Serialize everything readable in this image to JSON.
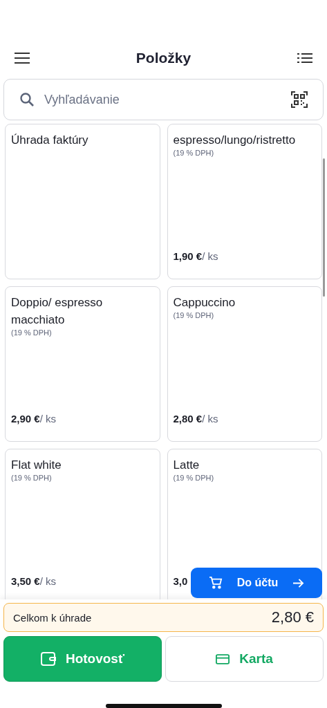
{
  "header": {
    "title": "Položky"
  },
  "search": {
    "placeholder": "Vyhľadávanie"
  },
  "items": [
    {
      "name": "Úhrada faktúry"
    },
    {
      "name": "espresso/lungo/ristretto",
      "vat": "(19 % DPH)",
      "price": "1,90 €",
      "unit": "/ ks"
    },
    {
      "name": "Doppio/ espresso macchiato",
      "vat": "(19 % DPH)",
      "price": "2,90 €",
      "unit": "/ ks"
    },
    {
      "name": "Cappuccino",
      "vat": "(19 % DPH)",
      "price": "2,80 €",
      "unit": "/ ks"
    },
    {
      "name": "Flat white",
      "vat": "(19 % DPH)",
      "price": "3,50 €",
      "unit": "/ ks"
    },
    {
      "name": "Latte",
      "vat": "(19 % DPH)",
      "price": "3,0"
    }
  ],
  "cart_button": {
    "label": "Do účtu"
  },
  "total": {
    "label": "Celkom k úhrade",
    "amount": "2,80 €"
  },
  "payments": [
    {
      "kind": "cash",
      "label": "Hotovosť"
    },
    {
      "kind": "card",
      "label": "Karta"
    }
  ]
}
